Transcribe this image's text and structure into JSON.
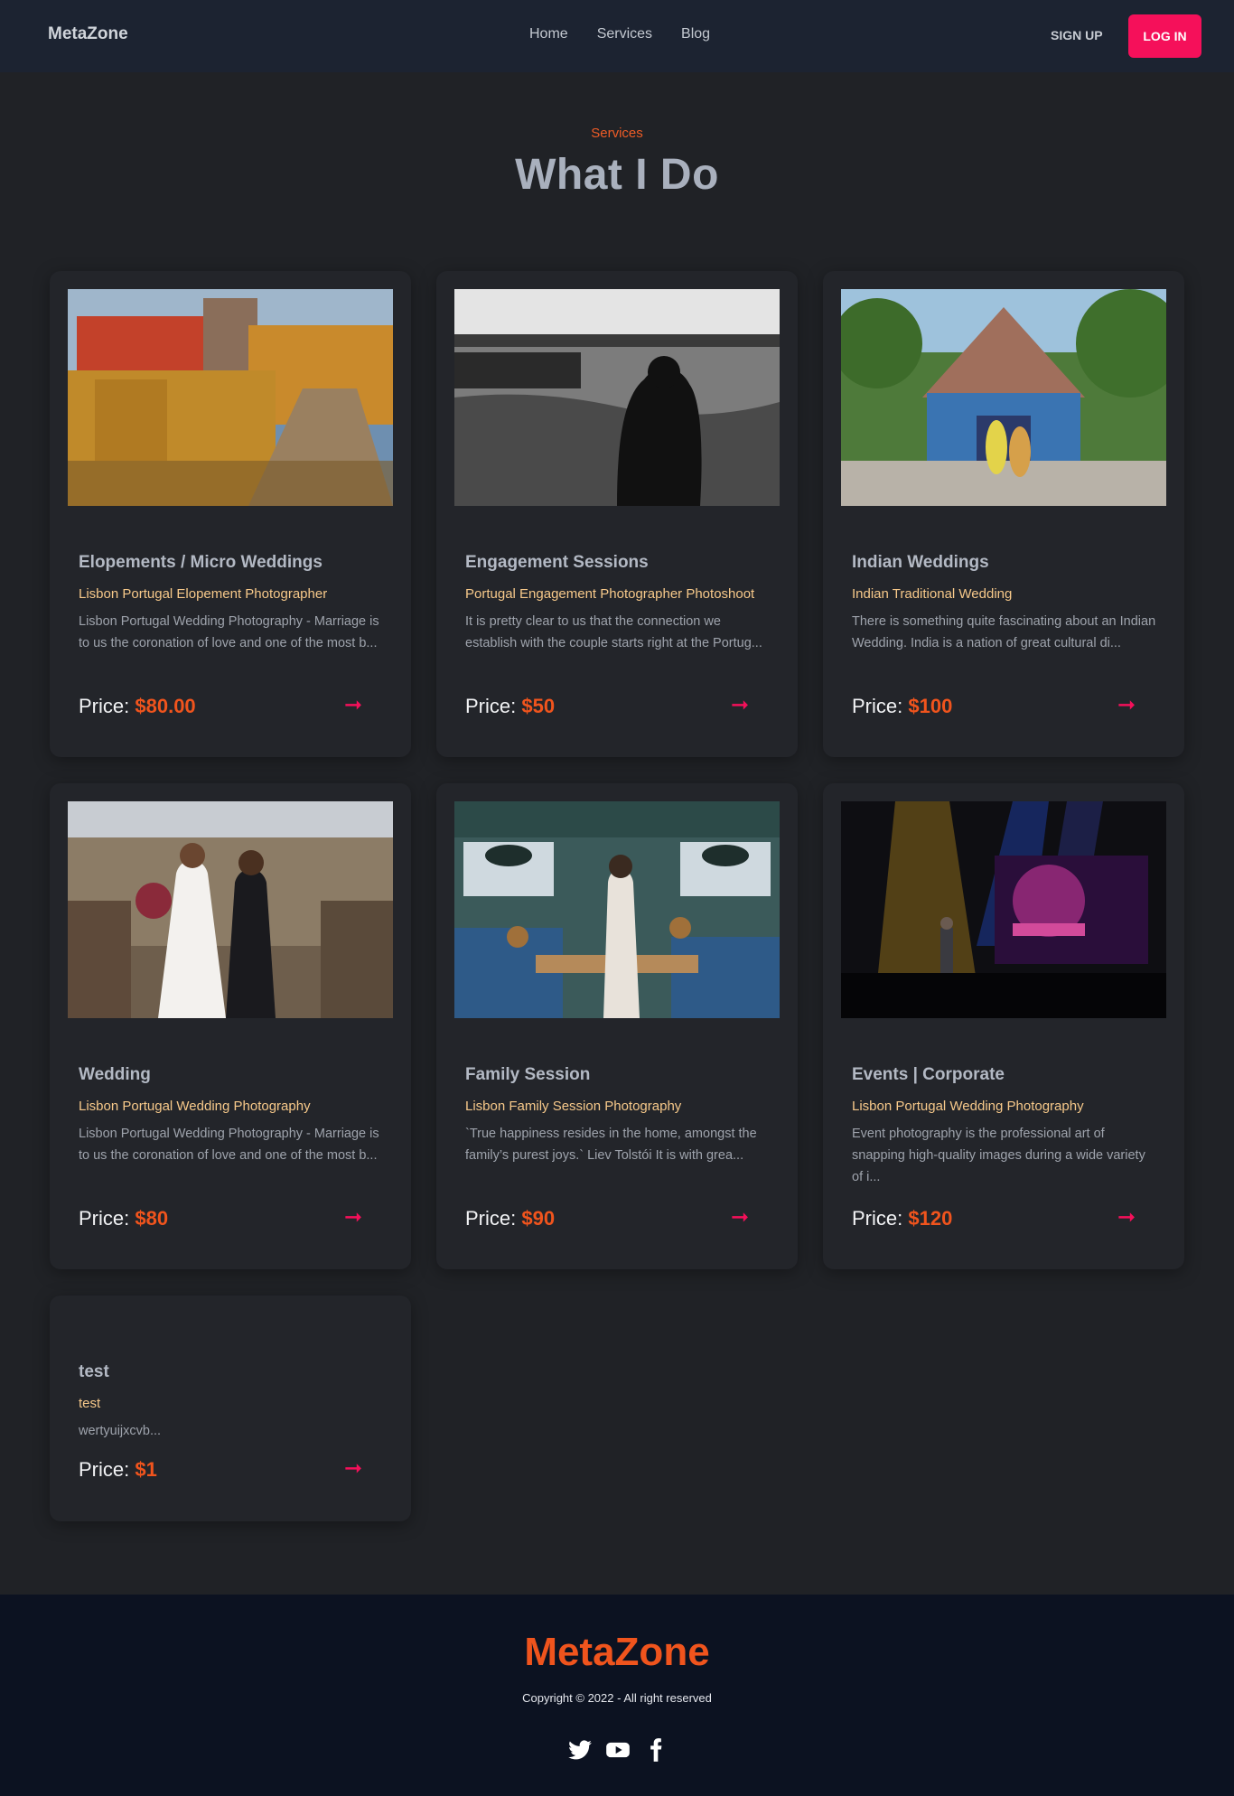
{
  "nav": {
    "brand": "MetaZone",
    "links": [
      "Home",
      "Services",
      "Blog"
    ],
    "signup": "SIGN UP",
    "login": "LOG IN"
  },
  "header": {
    "eyebrow": "Services",
    "title": "What I Do"
  },
  "price_label": "Price:",
  "cards": [
    {
      "title": "Elopements / Micro Weddings",
      "subtitle": "Lisbon Portugal Elopement Photographer",
      "desc": "Lisbon Portugal Wedding Photography - Marriage is to us the coronation of love and one of the most b...",
      "price": "$80.00"
    },
    {
      "title": "Engagement Sessions",
      "subtitle": "Portugal Engagement Photographer Photoshoot",
      "desc": "It is pretty clear to us that the connection we establish with the couple starts right at the Portug...",
      "price": "$50"
    },
    {
      "title": "Indian Weddings",
      "subtitle": "Indian Traditional Wedding",
      "desc": "There is something quite fascinating about an Indian Wedding. India is a nation of great cultural di...",
      "price": "$100"
    },
    {
      "title": "Wedding",
      "subtitle": "Lisbon Portugal Wedding Photography",
      "desc": "Lisbon Portugal Wedding Photography - Marriage is to us the coronation of love and one of the most b...",
      "price": "$80"
    },
    {
      "title": "Family Session",
      "subtitle": "Lisbon Family Session Photography",
      "desc": "`True happiness resides in the home, amongst the family’s purest joys.` Liev Tolstói It is with grea...",
      "price": "$90"
    },
    {
      "title": "Events | Corporate",
      "subtitle": "Lisbon Portugal Wedding Photography",
      "desc": "Event photography is the professional art of snapping high-quality images during a wide variety of i...",
      "price": "$120"
    },
    {
      "title": "test",
      "subtitle": "test",
      "desc": "wertyuijxcvb...",
      "price": "$1"
    }
  ],
  "footer": {
    "brand": "MetaZone",
    "copyright": "Copyright © 2022 - All right reserved"
  },
  "icons": {
    "arrow": "arrow-right-icon",
    "socials": [
      "twitter-icon",
      "youtube-icon",
      "facebook-icon"
    ]
  },
  "colors": {
    "accent": "#f5105a",
    "price": "#f0541d",
    "subtitle": "#f7c98a"
  }
}
